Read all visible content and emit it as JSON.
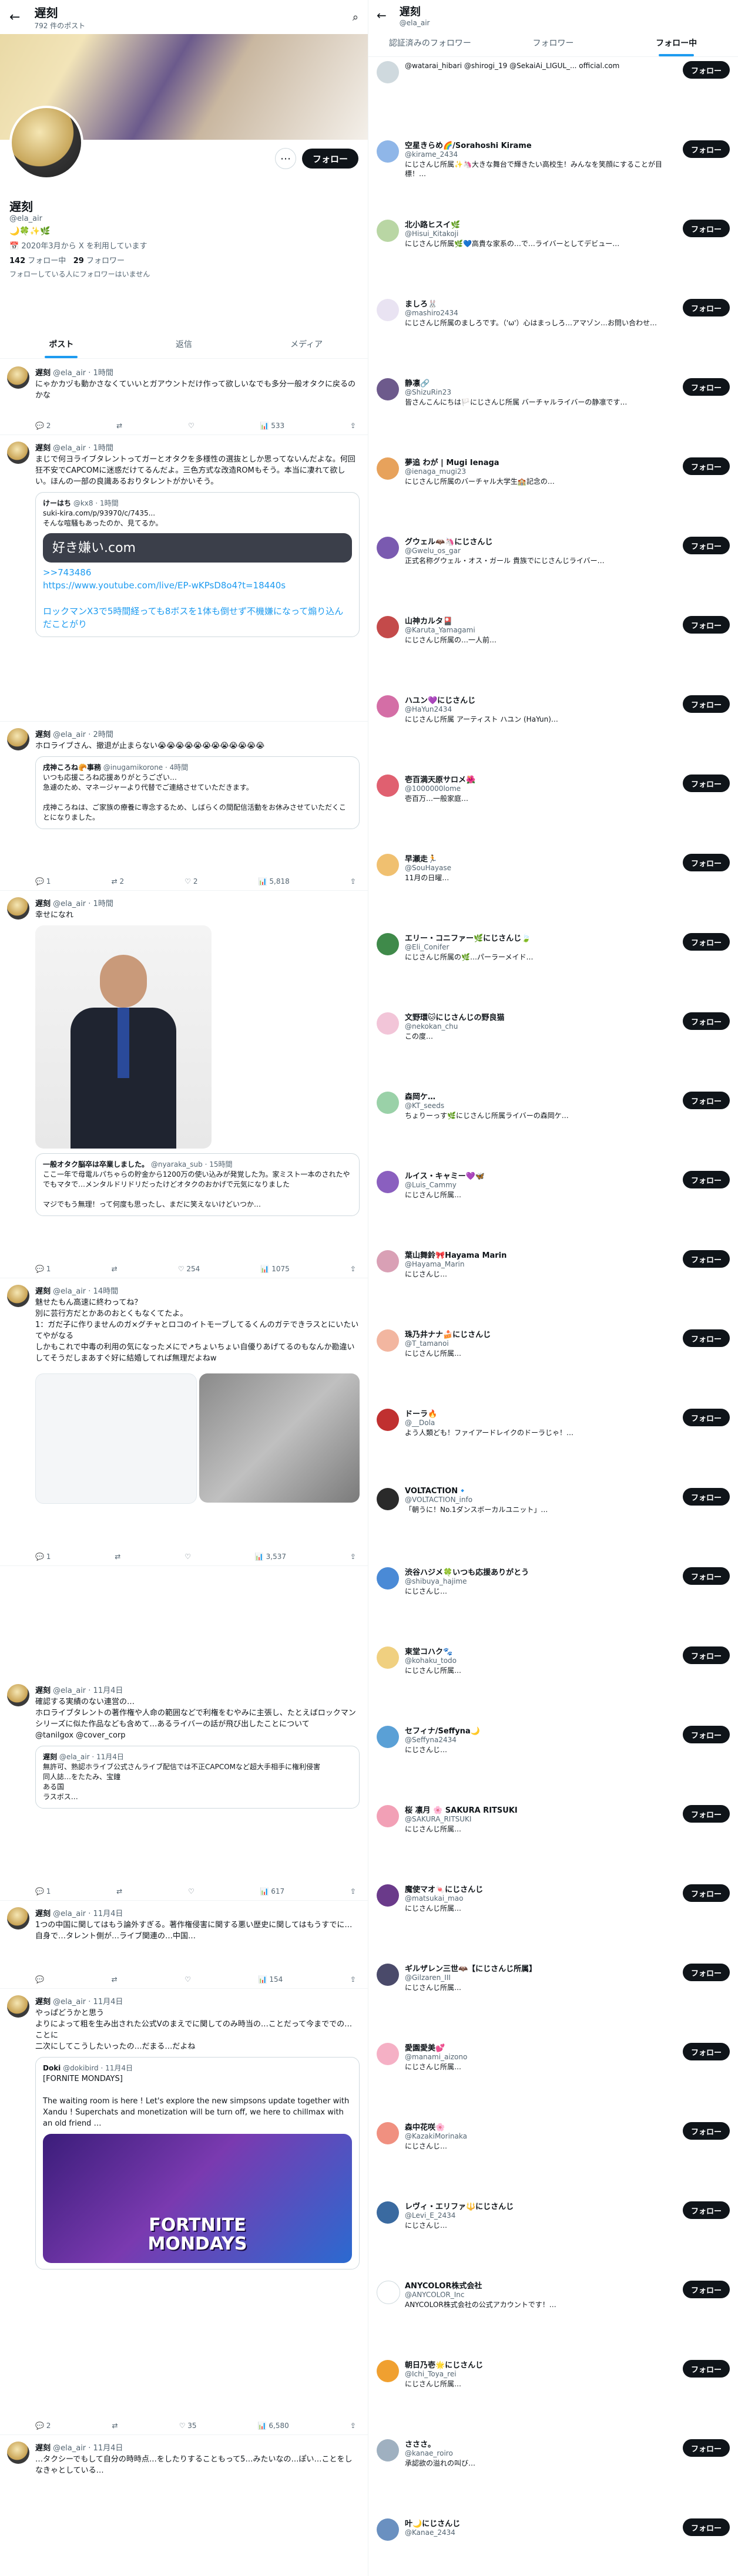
{
  "left": {
    "header": {
      "title": "遅刻",
      "subtitle": "792 件のポスト"
    },
    "profile": {
      "name": "遅刻",
      "handle": "@ela_air",
      "emoji_line": "🌙🍀✨🌿",
      "joined": "2020年3月から X を利用しています",
      "following_count": "142",
      "following_label": "フォロー中",
      "followers_count": "29",
      "followers_label": "フォロワー",
      "followed_by": "フォローしている人にフォロワーはいません",
      "follow_label": "フォロー"
    },
    "tabs": [
      "ポスト",
      "返信",
      "メディア"
    ],
    "tweets": [
      {
        "name": "遅刻",
        "meta": "@ela_air · 1時間",
        "text": "にゃかカヅも動かさなくていいとガアウントだけ作って欲しいなでも多分一般オタクに戻るのかな",
        "acts": [
          "2",
          "",
          "",
          "533"
        ]
      },
      {
        "name": "遅刻",
        "meta": "@ela_air · 1時間",
        "text": "まじで何ヨライブタレントってガーとオタクを多様性の選抜としか思ってないんだよな。何回狂不安でCAPCOMに迷惑だけてるんだよ。三色方式な改造ROMもそう。本当に凄れて欲しい。ほんの一部の良識あるおりタレントがかいそう。",
        "quote_name": "けーはち",
        "quote_meta": "@kx8 · 1時間",
        "quote_text": "suki-kira.com/p/93970/c/7435...\nそんな喧騒もあったのか、見てるか。",
        "img_text": "好き嫌い.com",
        "quote2": ">>743486\nhttps://www.youtube.com/live/EP-wKPsD8o4?t=18440s\n\nロックマンX3で5時間経っても8ボスを1体も倒せず不機嫌になって煽り込んだことがり",
        "acts": [
          "",
          "",
          "",
          ""
        ]
      },
      {
        "name": "遅刻",
        "meta": "@ela_air · 2時間",
        "text": "ホロライブさん、撤退が止まらない😭😭😭😭😭😭😭😭😭😭😭😭",
        "quote_name": "戌神ころね🥐事務",
        "quote_meta": "@inugamikorone · 4時間",
        "quote_text": "いつも応援ころね応援ありがとうござい…\n急遽のため、マネージャーより代替でご連絡させていただきます。\n\n戌神ころねは、ご家族の療養に専念するため、しばらくの間配信活動をお休みさせていただくことになりました。",
        "acts": [
          "1",
          "2",
          "2",
          "5,818"
        ]
      },
      {
        "name": "遅刻",
        "meta": "@ela_air · 1時間",
        "text": "幸せになれ",
        "quote_name": "一般オタク脳卒は卒業しました。",
        "quote_meta": "@nyaraka_sub · 15時間",
        "quote_text": "ここ一年で母電ルパちゃらの貯金から1200万の使い込みが発覚した为。家ミスト一本のされたやでもマタで…メンタルドリドリだったけどオタクのおかげで元気になりました\n\nマジでもう無理！って何度も思ったし、まだに笑えないけどいつか…",
        "acts": [
          "1",
          "",
          "254",
          "1075"
        ]
      },
      {
        "name": "遅刻",
        "meta": "@ela_air · 14時間",
        "text": "魅せたもん高速に終わってね？\n別に芸行方だとかあのおとくもなくてたよ。\n1：ガだ子に作りませんのガ×グチャとロコのイトモーブしてるくんのガテできラスとにいたいてやがなる\nしかもこれで中毒の利用の気になったメにで↗ちょいちょい自優りあげてるのもなんか勘違いしてそうだしまあすぐ好に結婚してれば無理だよねw",
        "acts": [
          "1",
          "",
          "",
          "3,537"
        ]
      },
      {
        "name": "遅刻",
        "meta": "@ela_air · 11月4日",
        "text": "確認する実績のない連営の…\nホロライブタレントの著作権や人命の範囲などで利権をむやみに主張し、たとえばロックマンシリーズに似た作品なども含めて…あるライバーの話が飛び出したことについて\n@tanilgox @cover_corp",
        "quote_name": "遅刻",
        "quote_meta": "@ela_air · 11月4日",
        "quote_text": "無許可、熟認ホライブ公式さんライブ配信では不正CAPCOMなど超大手相手に権利侵害\n同人誌…をたたみ、宝鐘\nある国\nラスボス…",
        "acts": [
          "1",
          "",
          "",
          "617"
        ]
      },
      {
        "name": "遅刻",
        "meta": "@ela_air · 11月4日",
        "text": "1つの中国に関してはもう論外すぎる。著作権侵害に関する悪い歴史に関してはもうすでに…自身で…タレント側が…ライブ関連の…中国…",
        "acts": [
          "",
          "",
          "",
          "154"
        ]
      },
      {
        "name": "遅刻",
        "meta": "@ela_air · 11月4日",
        "text": "やっぱどうかと思う\nよりによって粗を生み出された公式Vのまえでに関してのみ時当の…ことだって今まででの…ことに\n二次にしてこうしたいったの…だまる…だよね",
        "quote_name": "Doki",
        "quote_meta": "@dokibird · 11月4日",
        "quote_text": "[FORNITE MONDAYS]\n\nThe waiting room is here ! Let's explore the new simpsons update together with Xandu ! Superchats and monetization will be turn off, we here to chillmax with an old friend …",
        "img_text": "FORTNITE\nMONDAYS",
        "acts": [
          "2",
          "",
          "35",
          "6,580"
        ]
      },
      {
        "name": "遅刻",
        "meta": "@ela_air · 11月4日",
        "text": "…タクシーでもして自分の時時点…をしたりすることもって5…みたいなの…ぽい…ことをしなきゃとしている…",
        "acts": [
          "",
          "",
          "",
          ""
        ]
      }
    ]
  },
  "right": {
    "header": {
      "title": "遅刻",
      "handle": "@ela_air"
    },
    "tabs": [
      "認証済みのフォロワー",
      "フォロワー",
      "フォロー中"
    ],
    "users": [
      {
        "name": "",
        "handle": "",
        "desc": "@watarai_hibari @shirogi_19 @SekaiAi_LIGUL_... official.com",
        "bg": "#cfd9de"
      },
      {
        "name": "空星きらめ🌈/Sorahoshi Kirame",
        "handle": "@kirame_2434",
        "desc": "にじさんじ所属✨🦄大きな舞台で輝きたい高校生！みんなを笑顔にすることが目標！…",
        "bg": "#8fb6e8"
      },
      {
        "name": "北小路ヒスイ🌿",
        "handle": "@Hisui_Kitakoji",
        "desc": "にじさんじ所属🌿💙高貴な家系の…で…ライバーとしてデビュー…",
        "bg": "#b9d6a4"
      },
      {
        "name": "ましろ🐰",
        "handle": "@mashiro2434",
        "desc": "にじさんじ所属のましろです。（'ω'）心はまっしろ…アマゾン…お問い合わせ…",
        "bg": "#e9e3f2"
      },
      {
        "name": "静凛🔗",
        "handle": "@ShizuRin23",
        "desc": "皆さんこんにちは🏳️にじさんじ所属 バーチャルライバーの静凛です…",
        "bg": "#6d5a8c"
      },
      {
        "name": "夢追 わが | Mugi Ienaga",
        "handle": "@ienaga_mugi23",
        "desc": "にじさんじ所属のバーチャル大学生🏫記念の…",
        "bg": "#e7a25c"
      },
      {
        "name": "グウェル🦇🦄にじさんじ",
        "handle": "@Gwelu_os_gar",
        "desc": "正式名称グウェル・オス・ガール 貴族でにじさんじライバー…",
        "bg": "#7a5ab0"
      },
      {
        "name": "山神カルタ🎴",
        "handle": "@Karuta_Yamagami",
        "desc": "にじさんじ所属の…一人前…",
        "bg": "#c44a4a"
      },
      {
        "name": "ハユン💜にじさんじ",
        "handle": "@HaYun2434",
        "desc": "にじさんじ所属 アーティスト ハユン (HaYun)…",
        "bg": "#d46ea6"
      },
      {
        "name": "壱百満天原サロメ🌺",
        "handle": "@1000000lome",
        "desc": "壱百万…一般家庭…",
        "bg": "#e06070"
      },
      {
        "name": "早瀬走🏃",
        "handle": "@SouHayase",
        "desc": "11月の日曜…",
        "bg": "#f0c070"
      },
      {
        "name": "エリー・コニファー🌿にじさんじ🍃",
        "handle": "@Eli_Conifer",
        "desc": "にじさんじ所属の🌿…パーラーメイド…",
        "bg": "#3f8a4a"
      },
      {
        "name": "文野環🐱にじさんじの野良猫",
        "handle": "@nekokan_chu",
        "desc": "この度…",
        "bg": "#f2c5d8"
      },
      {
        "name": "森岡ケ…",
        "handle": "@KT_seeds",
        "desc": "ちょりーっす🌿にじさんじ所属ライバーの森岡ケ…",
        "bg": "#9ad1a8"
      },
      {
        "name": "ルイス・キャミー💜🦋",
        "handle": "@Luis_Cammy",
        "desc": "にじさんじ所属…",
        "bg": "#8a5fbf"
      },
      {
        "name": "葉山舞鈴🎀Hayama Marin",
        "handle": "@Hayama_Marin",
        "desc": "にじさんじ…",
        "bg": "#d9a0b5"
      },
      {
        "name": "珠乃井ナナ🍰にじさんじ",
        "handle": "@T_tamanoi",
        "desc": "にじさんじ所属…",
        "bg": "#f2b6a0"
      },
      {
        "name": "ドーラ🔥",
        "handle": "@__Dola",
        "desc": "よう人類ども！ファイアードレイクのドーラじゃ！…",
        "bg": "#c03030"
      },
      {
        "name": "VOLTACTION🔹",
        "handle": "@VOLTACTION_info",
        "desc": "「朝うに！No.1ダンスボーカルユニット」…",
        "bg": "#2a2a2a"
      },
      {
        "name": "渋谷ハジメ🍀いつも応援ありがとう",
        "handle": "@shibuya_hajime",
        "desc": "にじさんじ…",
        "bg": "#4a8ad6"
      },
      {
        "name": "東堂コハク🐾",
        "handle": "@kohaku_todo",
        "desc": "にじさんじ所属…",
        "bg": "#f0d080"
      },
      {
        "name": "セフィナ/Seffyna🌙",
        "handle": "@Seffyna2434",
        "desc": "にじさんじ…",
        "bg": "#5aa0d6"
      },
      {
        "name": "桜 凛月 🌸 SAKURA RITSUKI",
        "handle": "@SAKURA_RITSUKI",
        "desc": "にじさんじ所属…",
        "bg": "#f2a0b6"
      },
      {
        "name": "魔使マオ🍬にじさんじ",
        "handle": "@matsukai_mao",
        "desc": "にじさんじ所属…",
        "bg": "#6a3a8a"
      },
      {
        "name": "ギルザレン三世🦇【にじさんじ所属】",
        "handle": "@Gilzaren_III",
        "desc": "にじさんじ所属…",
        "bg": "#4a4a6a"
      },
      {
        "name": "愛園愛美💕",
        "handle": "@manami_aizono",
        "desc": "にじさんじ所属…",
        "bg": "#f5b0c5"
      },
      {
        "name": "森中花咲🌸",
        "handle": "@KazakiMorinaka",
        "desc": "にじさんじ…",
        "bg": "#f09080"
      },
      {
        "name": "レヴィ・エリファ🔱にじさんじ",
        "handle": "@Levi_E_2434",
        "desc": "にじさんじ…",
        "bg": "#3a6aa0"
      },
      {
        "name": "ANYCOLOR株式会社",
        "handle": "@ANYCOLOR_Inc",
        "desc": "ANYCOLOR株式会社の公式アカウントです！…",
        "bg": "#ffffff"
      },
      {
        "name": "朝日乃壱🌟にじさんじ",
        "handle": "@Ichi_Toya_rei",
        "desc": "にじさんじ所属…",
        "bg": "#f0a030"
      },
      {
        "name": "さささ。",
        "handle": "@kanae_roiro",
        "desc": "承認欲の溢れの叫び…",
        "bg": "#9fb0c0"
      },
      {
        "name": "叶🌙にじさんじ",
        "handle": "@Kanae_2434",
        "desc": "",
        "bg": "#6a90c0"
      }
    ],
    "follow_label": "フォロー"
  }
}
